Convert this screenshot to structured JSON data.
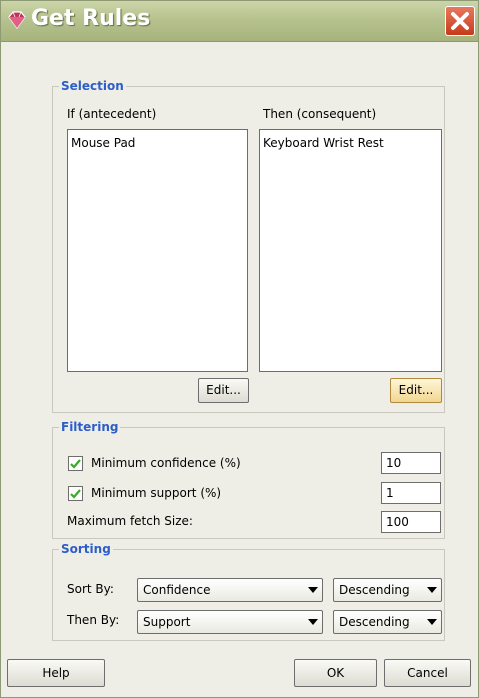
{
  "window": {
    "title": "Get Rules"
  },
  "selection": {
    "group_title": "Selection",
    "antecedent": {
      "header": "If (antecedent)",
      "items": [
        "Mouse Pad"
      ],
      "edit_label": "Edit..."
    },
    "consequent": {
      "header": "Then (consequent)",
      "items": [
        "Keyboard Wrist Rest"
      ],
      "edit_label": "Edit..."
    }
  },
  "filtering": {
    "group_title": "Filtering",
    "min_confidence": {
      "label": "Minimum confidence (%)",
      "checked": true,
      "value": "10"
    },
    "min_support": {
      "label": "Minimum support (%)",
      "checked": true,
      "value": "1"
    },
    "max_fetch": {
      "label": "Maximum fetch Size:",
      "value": "100"
    }
  },
  "sorting": {
    "group_title": "Sorting",
    "sort_by": {
      "label": "Sort By:",
      "field": "Confidence",
      "order": "Descending"
    },
    "then_by": {
      "label": "Then By:",
      "field": "Support",
      "order": "Descending"
    }
  },
  "footer": {
    "help_label": "Help",
    "ok_label": "OK",
    "cancel_label": "Cancel"
  },
  "colors": {
    "group_title": "#2d5ec8",
    "check": "#39a82b",
    "close_button": "#d0482a"
  }
}
